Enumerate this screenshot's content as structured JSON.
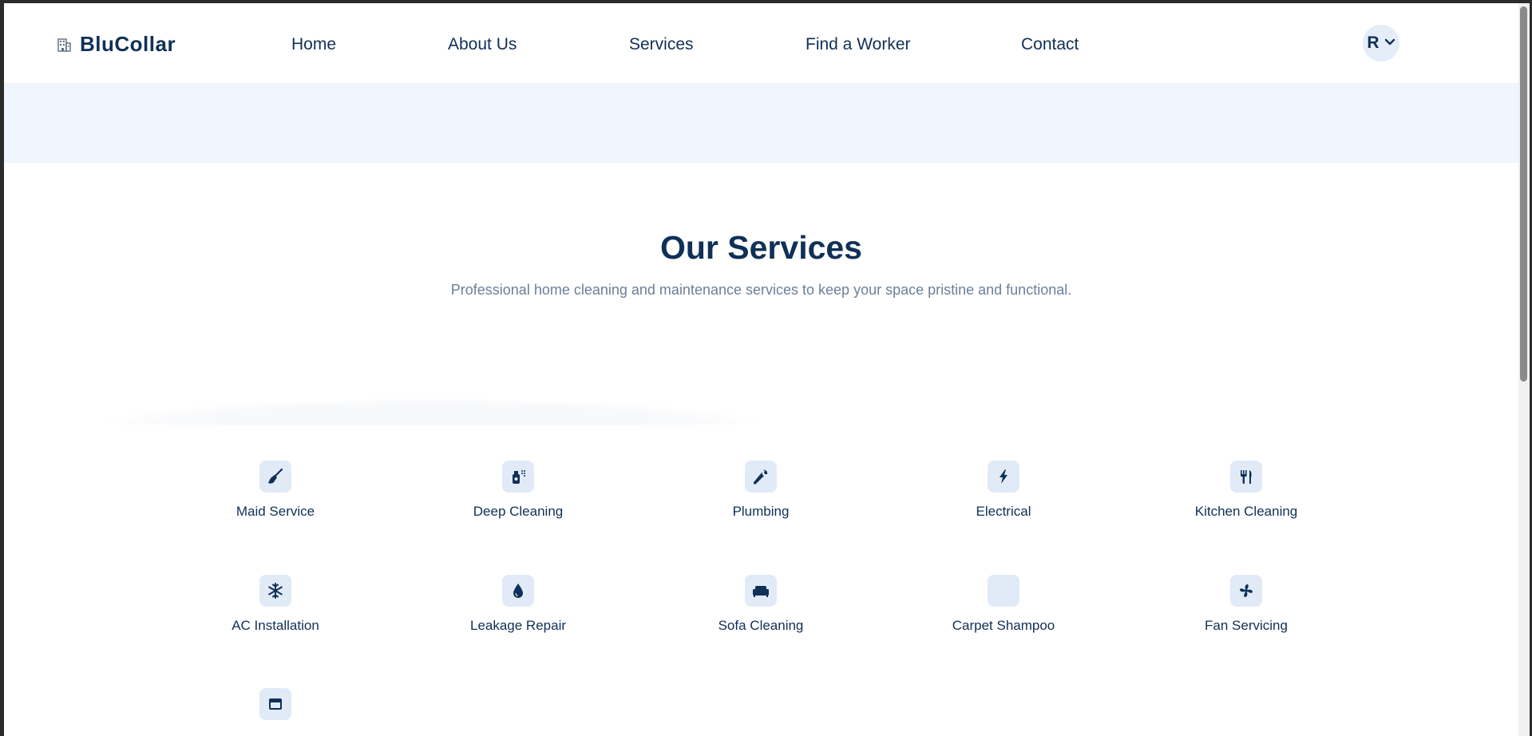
{
  "brand": {
    "name": "BluCollar",
    "icon": "building-icon"
  },
  "nav": {
    "links": [
      {
        "label": "Home"
      },
      {
        "label": "About Us"
      },
      {
        "label": "Services"
      },
      {
        "label": "Find a Worker"
      },
      {
        "label": "Contact"
      }
    ]
  },
  "profile": {
    "initial": "R",
    "icon": "chevron-down-icon"
  },
  "section": {
    "title": "Our Services",
    "subtitle": "Professional home cleaning and maintenance services to keep your space pristine and functional."
  },
  "services": [
    {
      "label": "Maid Service",
      "icon": "broom-icon"
    },
    {
      "label": "Deep Cleaning",
      "icon": "spray-bottle-icon"
    },
    {
      "label": "Plumbing",
      "icon": "wrench-icon"
    },
    {
      "label": "Electrical",
      "icon": "bolt-icon"
    },
    {
      "label": "Kitchen Cleaning",
      "icon": "utensils-icon"
    },
    {
      "label": "AC Installation",
      "icon": "snowflake-icon"
    },
    {
      "label": "Leakage Repair",
      "icon": "water-drop-icon"
    },
    {
      "label": "Sofa Cleaning",
      "icon": "couch-icon"
    },
    {
      "label": "Carpet Shampoo",
      "icon": "blank-icon"
    },
    {
      "label": "Fan Servicing",
      "icon": "fan-icon"
    },
    {
      "label": "",
      "icon": "window-icon"
    }
  ],
  "colors": {
    "primary": "#0f3057",
    "muted": "#6b7f99",
    "hero_band": "#f0f6fd",
    "icon_bg": "#e1ebf7"
  }
}
